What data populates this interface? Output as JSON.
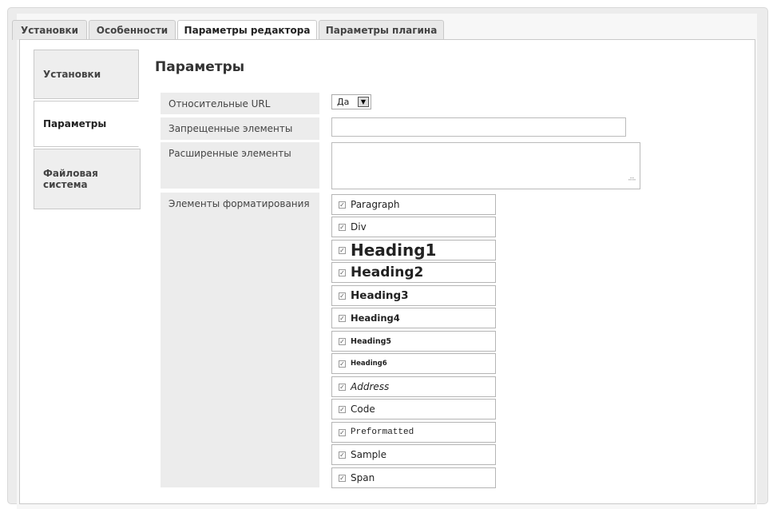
{
  "tabs": [
    {
      "label": "Установки"
    },
    {
      "label": "Особенности"
    },
    {
      "label": "Параметры редактора"
    },
    {
      "label": "Параметры плагина"
    }
  ],
  "side_tabs": [
    {
      "label": "Установки"
    },
    {
      "label": "Параметры"
    },
    {
      "label": "Файловая система"
    }
  ],
  "section_title": "Параметры",
  "rows": {
    "relative_url": {
      "label": "Относительные URL",
      "value": "Да"
    },
    "forbidden": {
      "label": "Запрещенные элементы",
      "value": ""
    },
    "extended": {
      "label": "Расширенные элементы",
      "value": ""
    },
    "formatting": {
      "label": "Элементы форматирования"
    }
  },
  "format_items": [
    {
      "label": "Paragraph",
      "checked": true
    },
    {
      "label": "Div",
      "checked": true
    },
    {
      "label": "Heading1",
      "checked": true
    },
    {
      "label": "Heading2",
      "checked": true
    },
    {
      "label": "Heading3",
      "checked": true
    },
    {
      "label": "Heading4",
      "checked": true
    },
    {
      "label": "Heading5",
      "checked": true
    },
    {
      "label": "Heading6",
      "checked": true
    },
    {
      "label": "Address",
      "checked": true
    },
    {
      "label": "Code",
      "checked": true
    },
    {
      "label": "Preformatted",
      "checked": true
    },
    {
      "label": "Sample",
      "checked": true
    },
    {
      "label": "Span",
      "checked": true
    }
  ],
  "icons": {
    "checkbox": "checkbox-checked-icon",
    "dropdown": "chevron-down-icon",
    "resize": "resize-grip-icon"
  }
}
